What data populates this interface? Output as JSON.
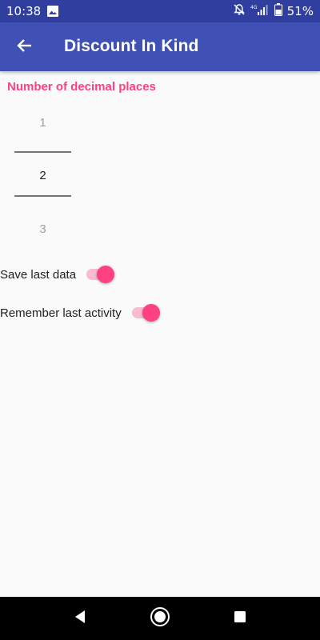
{
  "status_bar": {
    "time": "10:38",
    "battery_text": "51%",
    "icons": [
      "image-icon",
      "notifications-off-icon",
      "signal-4g-icon",
      "battery-icon"
    ]
  },
  "app_bar": {
    "title": "Discount In Kind",
    "back_icon": "arrow-back-icon"
  },
  "decimal_places": {
    "heading": "Number of decimal places",
    "above": "1",
    "selected": "2",
    "below": "3"
  },
  "toggles": [
    {
      "label": "Save last data",
      "on": true
    },
    {
      "label": "Remember last activity",
      "on": true
    }
  ],
  "nav_bar": {
    "buttons": [
      "back-triangle-icon",
      "home-circle-icon",
      "recents-square-icon"
    ]
  },
  "colors": {
    "status_bar": "#303f9f",
    "app_bar": "#3f51b5",
    "accent": "#ff4081",
    "switch_track": "#f8bbd0"
  }
}
